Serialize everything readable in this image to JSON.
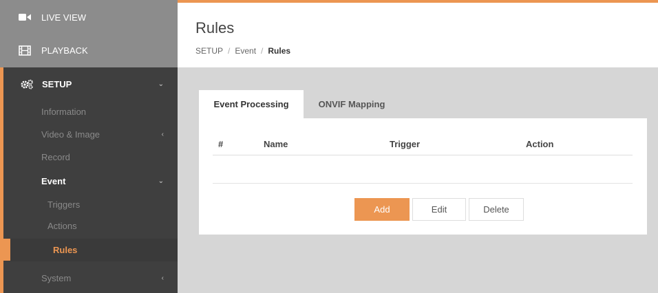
{
  "sidebar": {
    "live_view": {
      "label": "LIVE VIEW",
      "icon": "video-camera-icon"
    },
    "playback": {
      "label": "PLAYBACK",
      "icon": "film-icon"
    },
    "setup": {
      "label": "SETUP",
      "icon": "gears-icon"
    },
    "items": [
      {
        "label": "Information"
      },
      {
        "label": "Video & Image"
      },
      {
        "label": "Record"
      },
      {
        "label": "Event"
      },
      {
        "label": "Triggers"
      },
      {
        "label": "Actions"
      },
      {
        "label": "Rules"
      },
      {
        "label": "System"
      }
    ]
  },
  "header": {
    "title": "Rules",
    "breadcrumb": [
      "SETUP",
      "Event",
      "Rules"
    ],
    "separator": "/"
  },
  "tabs": [
    {
      "label": "Event Processing"
    },
    {
      "label": "ONVIF Mapping"
    }
  ],
  "table": {
    "columns": [
      "#",
      "Name",
      "Trigger",
      "Action"
    ]
  },
  "buttons": {
    "add": "Add",
    "edit": "Edit",
    "delete": "Delete"
  },
  "colors": {
    "accent": "#ec9652",
    "sidebar_bg": "#3f3f3f",
    "sidebar_top_bg": "#8c8c8c",
    "content_bg": "#d6d6d6"
  }
}
